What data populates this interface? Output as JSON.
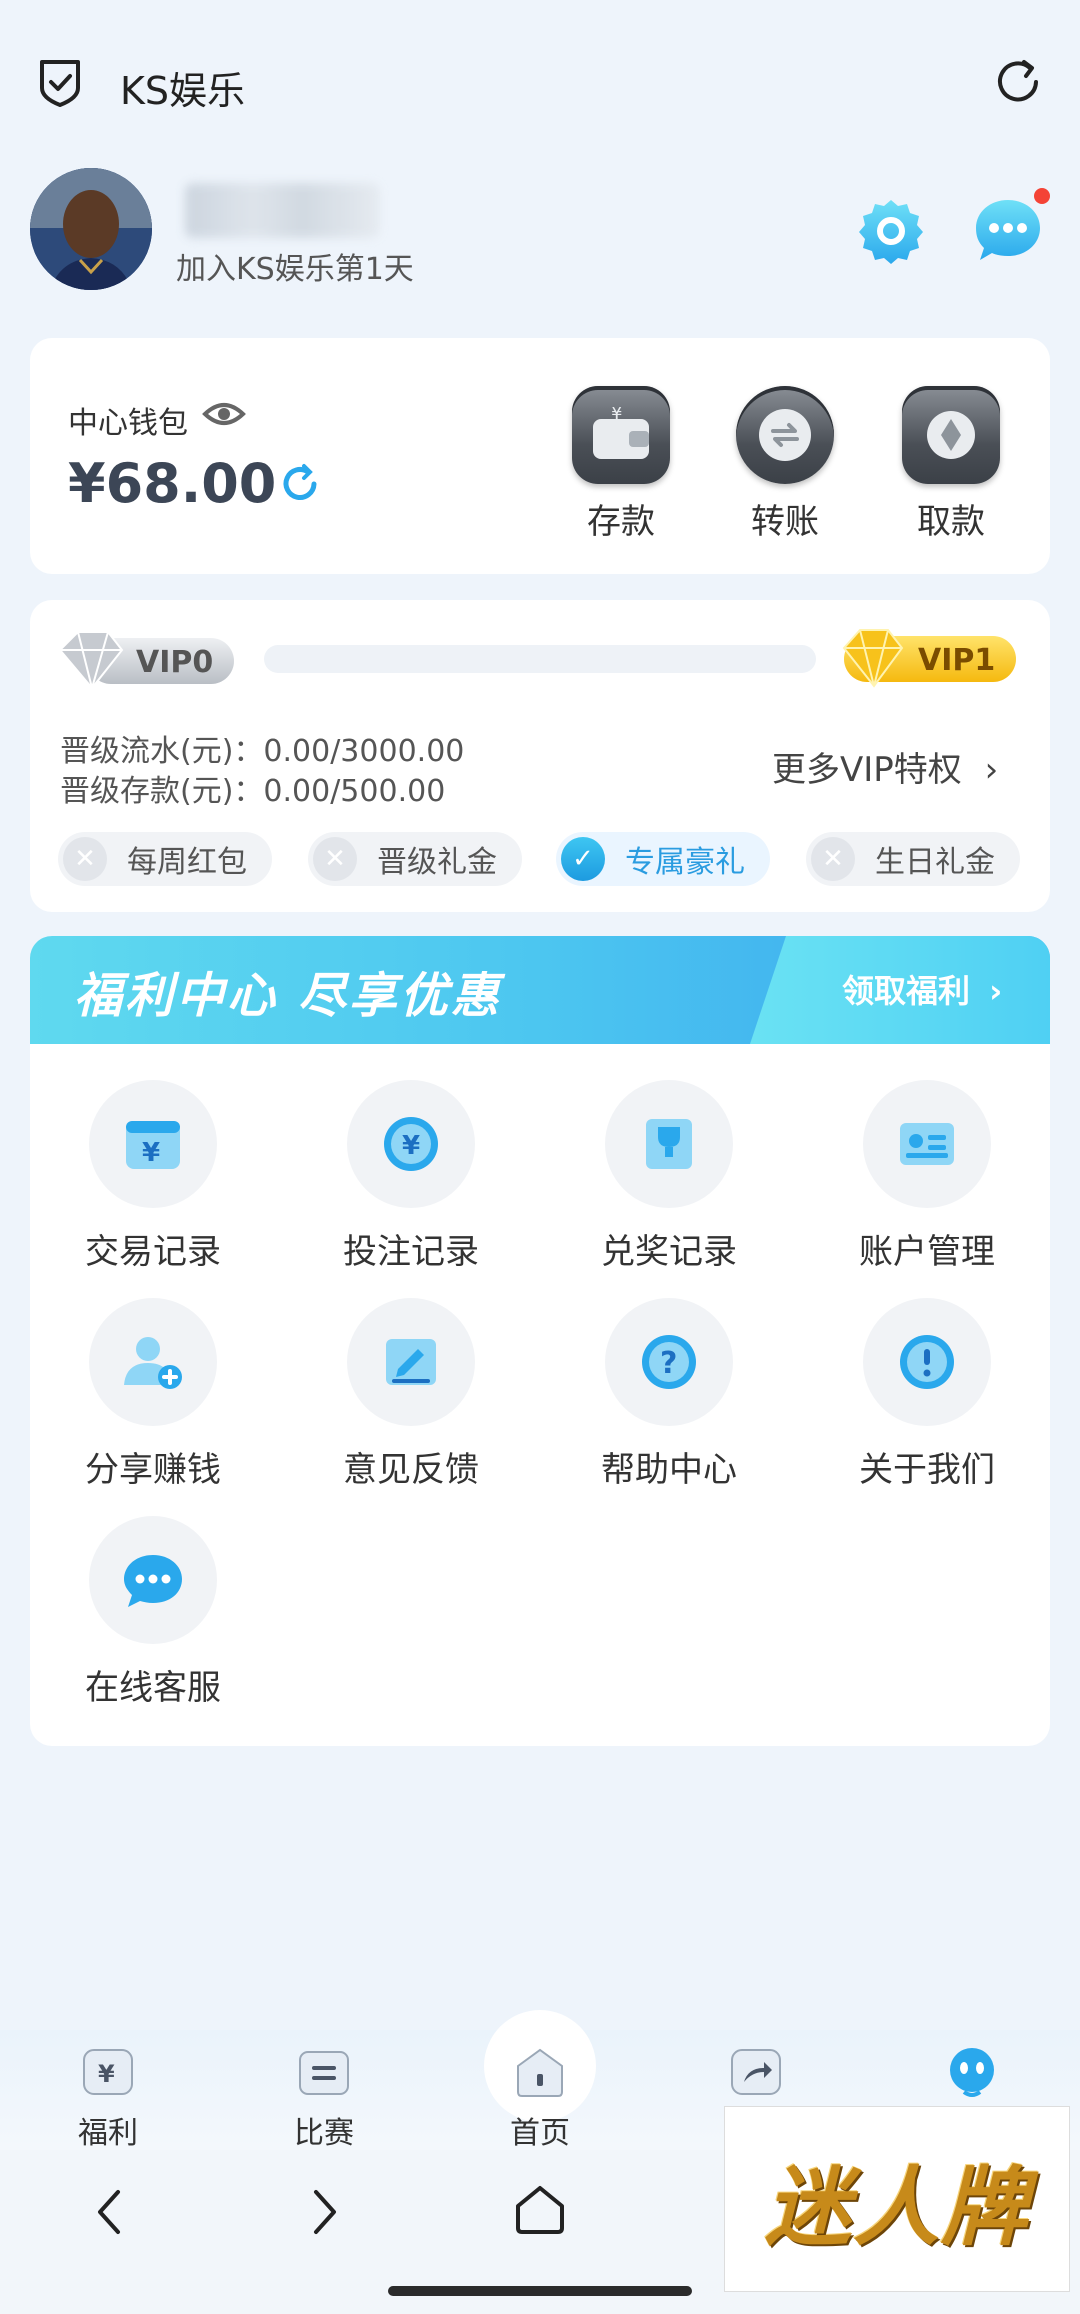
{
  "topbar": {
    "title": "KS娱乐"
  },
  "profile": {
    "join_days": "加入KS娱乐第1天"
  },
  "wallet": {
    "label": "中心钱包",
    "balance": "¥68.00",
    "actions": [
      {
        "label": "存款",
        "icon": "wallet-icon"
      },
      {
        "label": "转账",
        "icon": "transfer-icon"
      },
      {
        "label": "取款",
        "icon": "withdraw-icon"
      }
    ]
  },
  "vip": {
    "current_level": "VIP0",
    "next_level": "VIP1",
    "progress": 0,
    "flow_line": "晋级流水(元)：0.00/3000.00",
    "deposit_line": "晋级存款(元)：0.00/500.00",
    "more_link": "更多VIP特权",
    "perks": [
      {
        "label": "每周红包",
        "active": false
      },
      {
        "label": "晋级礼金",
        "active": false
      },
      {
        "label": "专属豪礼",
        "active": true
      },
      {
        "label": "生日礼金",
        "active": false
      }
    ]
  },
  "welfare": {
    "banner_title": "福利中心 尽享优惠",
    "banner_link": "领取福利",
    "items": [
      {
        "label": "交易记录",
        "icon": "calendar-yen-icon"
      },
      {
        "label": "投注记录",
        "icon": "yen-coin-icon"
      },
      {
        "label": "兑奖记录",
        "icon": "trophy-icon"
      },
      {
        "label": "账户管理",
        "icon": "id-card-icon"
      },
      {
        "label": "分享赚钱",
        "icon": "user-add-icon"
      },
      {
        "label": "意见反馈",
        "icon": "edit-icon"
      },
      {
        "label": "帮助中心",
        "icon": "question-icon"
      },
      {
        "label": "关于我们",
        "icon": "info-icon"
      },
      {
        "label": "在线客服",
        "icon": "chat-icon"
      }
    ]
  },
  "tabbar": {
    "items": [
      {
        "label": "福利",
        "icon": "yen-gift-icon"
      },
      {
        "label": "比赛",
        "icon": "schedule-icon"
      },
      {
        "label": "首页",
        "icon": "home-icon"
      },
      {
        "label": "",
        "icon": "share-icon"
      },
      {
        "label": "",
        "icon": "robot-icon"
      }
    ]
  },
  "watermark": {
    "text": "迷人牌"
  },
  "colors": {
    "accent": "#2a9ce0",
    "banner": "#4cc6f0",
    "red_dot": "#f44336"
  }
}
